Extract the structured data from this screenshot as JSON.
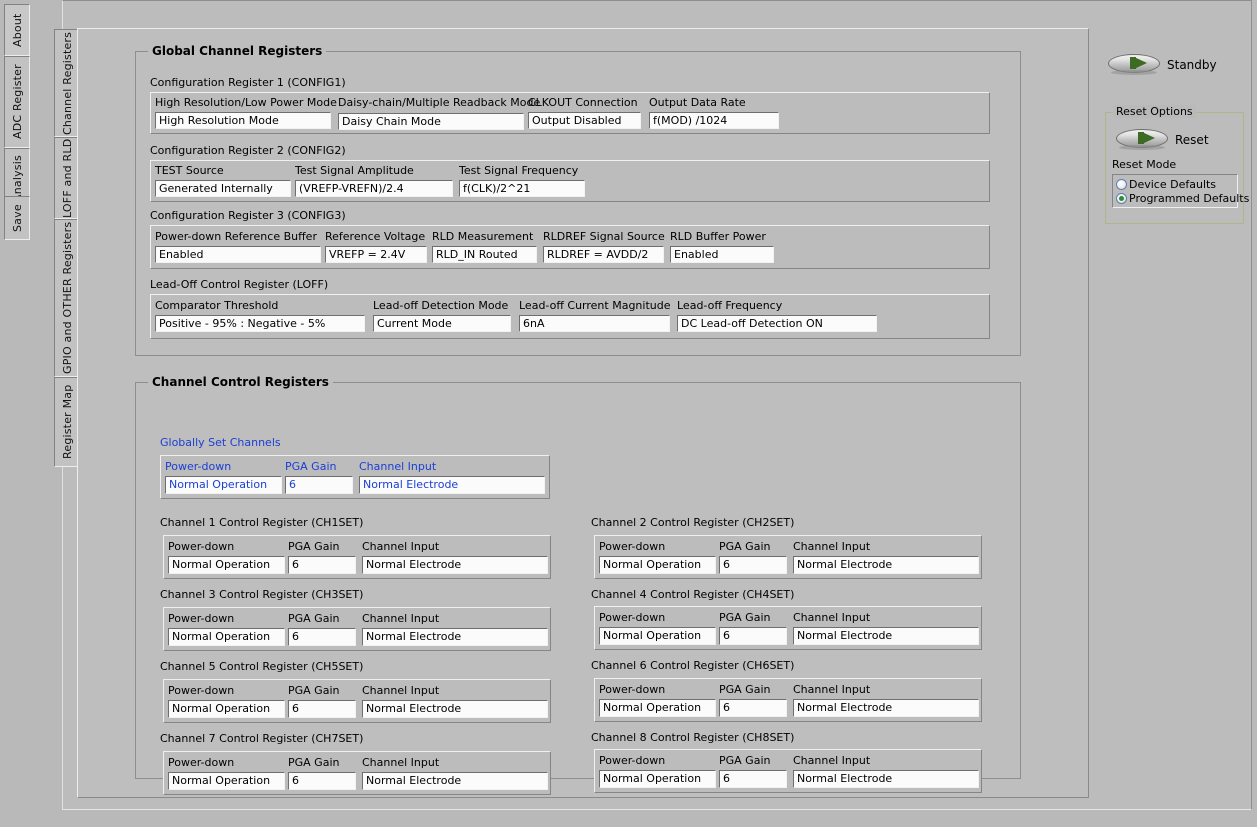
{
  "outer_tabs": [
    {
      "label": "About",
      "selected": false
    },
    {
      "label": "ADC Register",
      "selected": true
    },
    {
      "label": "Analysis",
      "selected": false
    },
    {
      "label": "Save",
      "selected": false
    }
  ],
  "inner_tabs": [
    {
      "label": "Channel Registers",
      "selected": true
    },
    {
      "label": "LOFF and RLD",
      "selected": false
    },
    {
      "label": "GPIO and OTHER Registers",
      "selected": false
    },
    {
      "label": "Register Map",
      "selected": false
    }
  ],
  "global_group": {
    "title": "Global Channel Registers",
    "registers": [
      {
        "name": "Configuration Register 1 (CONFIG1)",
        "fields": [
          {
            "label": "High Resolution/Low Power Mode",
            "value": "High Resolution Mode"
          },
          {
            "label": "Daisy-chain/Multiple Readback Mode",
            "value": "Daisy Chain Mode"
          },
          {
            "label": "CLKOUT Connection",
            "value": "Output Disabled"
          },
          {
            "label": "Output Data Rate",
            "value": "f(MOD) /1024"
          }
        ]
      },
      {
        "name": "Configuration Register 2 (CONFIG2)",
        "fields": [
          {
            "label": "TEST Source",
            "value": "Generated Internally"
          },
          {
            "label": "Test Signal Amplitude",
            "value": "(VREFP-VREFN)/2.4"
          },
          {
            "label": "Test Signal Frequency",
            "value": "f(CLK)/2^21"
          }
        ]
      },
      {
        "name": "Configuration Register 3 (CONFIG3)",
        "fields": [
          {
            "label": "Power-down Reference Buffer",
            "value": "Enabled"
          },
          {
            "label": "Reference Voltage",
            "value": "VREFP = 2.4V"
          },
          {
            "label": "RLD Measurement",
            "value": "RLD_IN Routed"
          },
          {
            "label": "RLDREF Signal Source",
            "value": "RLDREF = AVDD/2"
          },
          {
            "label": "RLD Buffer Power",
            "value": "Enabled"
          }
        ]
      },
      {
        "name": "Lead-Off Control Register (LOFF)",
        "fields": [
          {
            "label": "Comparator Threshold",
            "value": "Positive - 95% : Negative - 5%"
          },
          {
            "label": "Lead-off Detection Mode",
            "value": "Current Mode"
          },
          {
            "label": "Lead-off Current Magnitude",
            "value": "6nA"
          },
          {
            "label": "Lead-off Frequency",
            "value": "DC Lead-off Detection ON"
          }
        ]
      }
    ]
  },
  "channel_group": {
    "title": "Channel Control Registers",
    "global_channel": {
      "name": "Globally Set Channels",
      "col_labels": [
        "Power-down",
        "PGA Gain",
        "Channel Input"
      ],
      "values": [
        "Normal Operation",
        "6",
        "Normal Electrode"
      ]
    },
    "col_labels": [
      "Power-down",
      "PGA Gain",
      "Channel Input"
    ],
    "channels": [
      {
        "name": "Channel 1 Control Register (CH1SET)",
        "values": [
          "Normal Operation",
          "6",
          "Normal Electrode"
        ]
      },
      {
        "name": "Channel 2 Control Register (CH2SET)",
        "values": [
          "Normal Operation",
          "6",
          "Normal Electrode"
        ]
      },
      {
        "name": "Channel 3 Control Register (CH3SET)",
        "values": [
          "Normal Operation",
          "6",
          "Normal Electrode"
        ]
      },
      {
        "name": "Channel 4 Control Register (CH4SET)",
        "values": [
          "Normal Operation",
          "6",
          "Normal Electrode"
        ]
      },
      {
        "name": "Channel 5 Control Register (CH5SET)",
        "values": [
          "Normal Operation",
          "6",
          "Normal Electrode"
        ]
      },
      {
        "name": "Channel 6 Control Register (CH6SET)",
        "values": [
          "Normal Operation",
          "6",
          "Normal Electrode"
        ]
      },
      {
        "name": "Channel 7 Control Register (CH7SET)",
        "values": [
          "Normal Operation",
          "6",
          "Normal Electrode"
        ]
      },
      {
        "name": "Channel 8 Control Register (CH8SET)",
        "values": [
          "Normal Operation",
          "6",
          "Normal Electrode"
        ]
      }
    ]
  },
  "right_panel": {
    "standby_label": "Standby",
    "reset_options_title": "Reset Options",
    "reset_label": "Reset",
    "reset_mode_label": "Reset Mode",
    "reset_modes": [
      {
        "label": "Device Defaults",
        "checked": false
      },
      {
        "label": "Programmed Defaults",
        "checked": true
      }
    ]
  },
  "colors": {
    "background": "#b9b9b9",
    "panel": "#bebebe",
    "accent_blue": "#1a3fd4",
    "toggle_green": "#3d6b23",
    "radio_green": "#2e8b2e"
  }
}
